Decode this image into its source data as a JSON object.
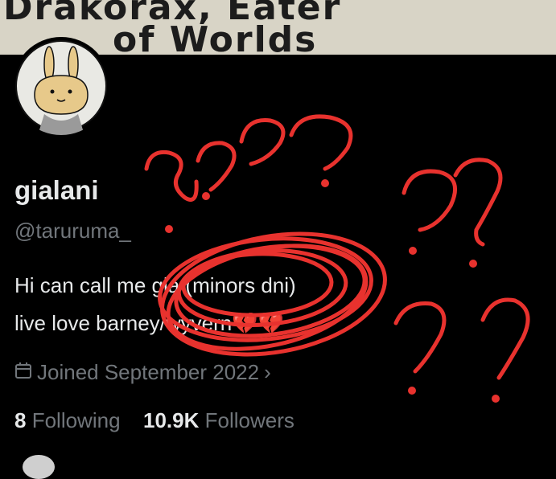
{
  "banner": {
    "line1": "Drakorax, Eater",
    "line2": "of Worlds"
  },
  "profile": {
    "display_name": "gialani",
    "handle": "@taruruma_",
    "bio_line1": "Hi can call me gia (minors dni)",
    "bio_line2": "live love barney/wyvern",
    "bio_emoji": "💔💔",
    "joined": "Joined September 2022",
    "joined_chevron": "›"
  },
  "stats": {
    "following_count": "8",
    "following_label": "Following",
    "followers_count": "10.9K",
    "followers_label": "Followers"
  },
  "icons": {
    "calendar": "calendar-icon",
    "chevron": "chevron-right-icon"
  },
  "colors": {
    "scribble": "#e8322e",
    "secondary_text": "#71767b",
    "primary_text": "#e7e9ea"
  }
}
